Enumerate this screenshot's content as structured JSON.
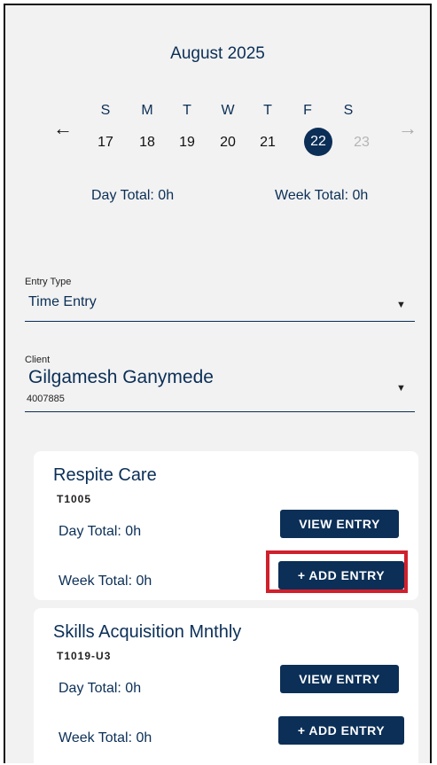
{
  "calendar": {
    "month_label": "August 2025",
    "prev_arrow": "←",
    "next_arrow": "→",
    "days": [
      {
        "dow": "S",
        "date": "17",
        "state": "normal"
      },
      {
        "dow": "M",
        "date": "18",
        "state": "normal"
      },
      {
        "dow": "T",
        "date": "19",
        "state": "normal"
      },
      {
        "dow": "W",
        "date": "20",
        "state": "normal"
      },
      {
        "dow": "T",
        "date": "21",
        "state": "normal"
      },
      {
        "dow": "F",
        "date": "22",
        "state": "selected"
      },
      {
        "dow": "S",
        "date": "23",
        "state": "disabled"
      }
    ],
    "day_total": "Day Total: 0h",
    "week_total": "Week Total: 0h"
  },
  "entry_type": {
    "label": "Entry Type",
    "value": "Time Entry",
    "caret": "▼"
  },
  "client": {
    "label": "Client",
    "name": "Gilgamesh Ganymede",
    "id": "4007885",
    "caret": "▼"
  },
  "services": [
    {
      "title": "Respite Care",
      "code": "T1005",
      "day_total": "Day Total: 0h",
      "week_total": "Week Total: 0h",
      "view_label": "VIEW ENTRY",
      "add_label": "+ ADD ENTRY"
    },
    {
      "title": "Skills Acquisition Mnthly",
      "code": "T1019-U3",
      "day_total": "Day Total: 0h",
      "week_total": "Week Total: 0h",
      "view_label": "VIEW ENTRY",
      "add_label": "+ ADD ENTRY"
    }
  ],
  "colors": {
    "navy": "#0b2f57",
    "background": "#f2f2f2",
    "highlight": "#d0202c"
  }
}
